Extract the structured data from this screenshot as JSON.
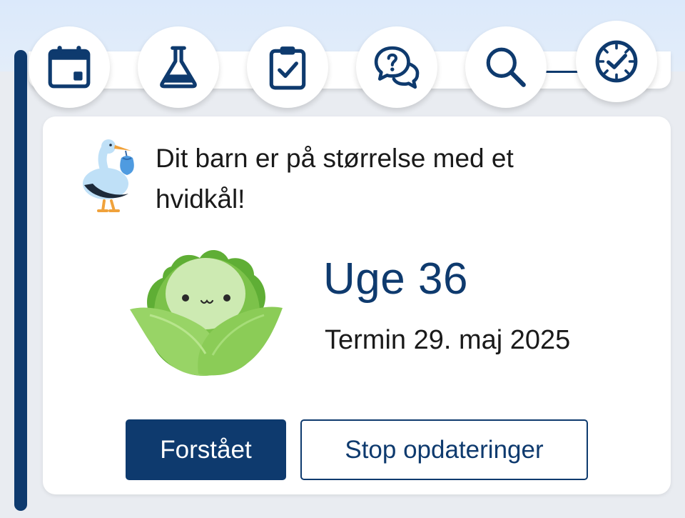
{
  "nav": {
    "icons": [
      {
        "name": "calendar-icon"
      },
      {
        "name": "flask-icon"
      },
      {
        "name": "clipboard-check-icon"
      },
      {
        "name": "question-chat-icon"
      },
      {
        "name": "search-icon"
      },
      {
        "name": "clock-check-icon"
      }
    ]
  },
  "card": {
    "message": "Dit barn er på størrelse med et hvidkål!",
    "week": "Uge 36",
    "due_date": "Termin 29. maj 2025",
    "primary_button": "Forstået",
    "secondary_button": "Stop opdateringer"
  },
  "colors": {
    "accent": "#0e3a6e",
    "background": "#e9ecf1",
    "card": "#ffffff",
    "cabbage_green": "#7cc24a"
  }
}
